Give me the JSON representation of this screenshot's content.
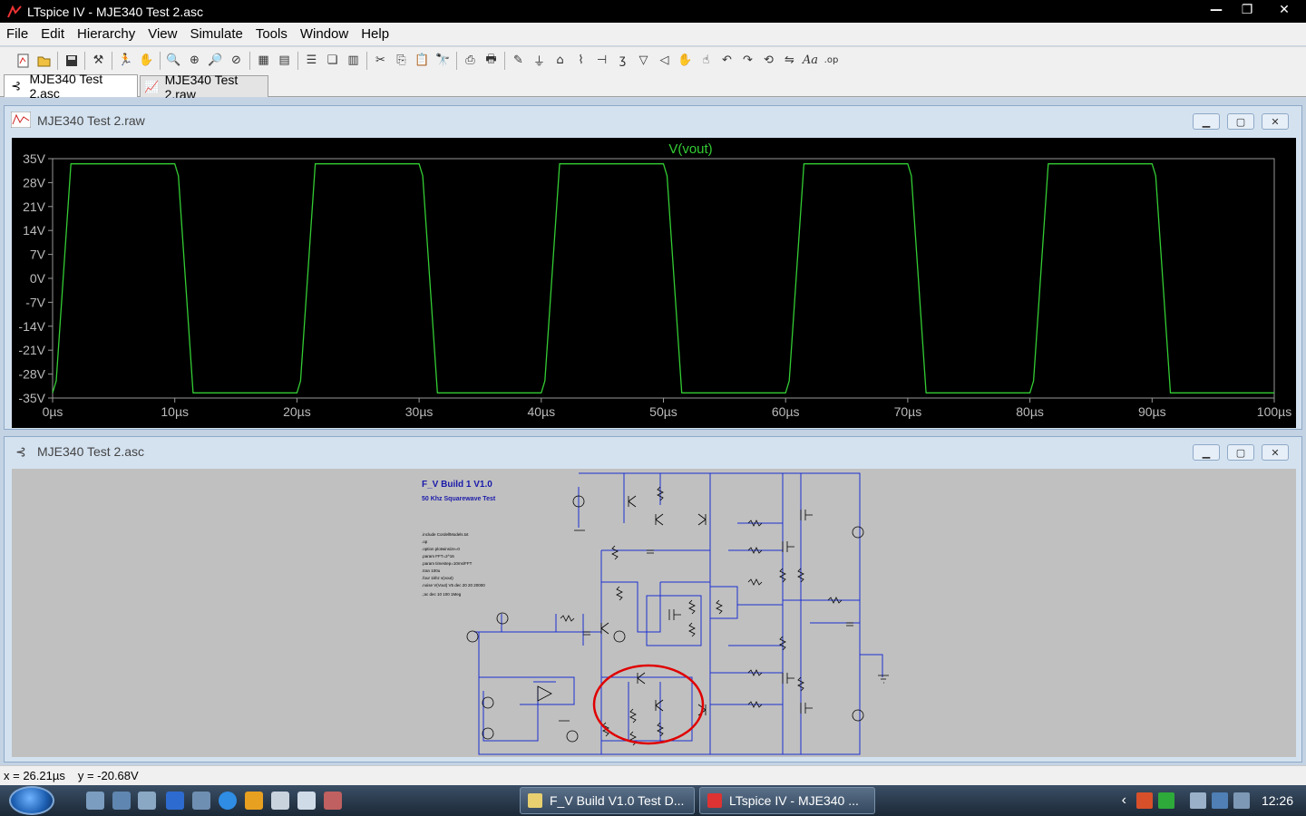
{
  "window": {
    "title": "LTspice IV - MJE340 Test 2.asc"
  },
  "menu": [
    "File",
    "Edit",
    "Hierarchy",
    "View",
    "Simulate",
    "Tools",
    "Window",
    "Help"
  ],
  "tabs": [
    {
      "label": "MJE340 Test 2.asc",
      "icon": "schematic-icon"
    },
    {
      "label": "MJE340 Test 2.raw",
      "icon": "waveform-icon"
    }
  ],
  "plot_window": {
    "title": "MJE340 Test 2.raw",
    "trace_label": "V(vout)",
    "trace_color": "#33cc33"
  },
  "schematic_window": {
    "title": "MJE340 Test 2.asc",
    "heading": "F_V Build 1 V1.0",
    "subheading": "50 Khz Squarewave Test",
    "directives": [
      ".include CordellModels.txt",
      ".op",
      ".option plotwinsize=0",
      ".param FFT=2^16",
      ".param timestep=10ms/FFT",
      ".tran 100u",
      ".four 1khz v(vout)",
      ".noise V(Vout) V5 dec 20 20 20000",
      ".;ac dec 10 100 1Meg"
    ],
    "annotation_color": "#e00000"
  },
  "chart_data": {
    "type": "line",
    "title": "V(vout)",
    "x_ticks": [
      "0µs",
      "10µs",
      "20µs",
      "30µs",
      "40µs",
      "50µs",
      "60µs",
      "70µs",
      "80µs",
      "90µs",
      "100µs"
    ],
    "y_ticks": [
      "35V",
      "28V",
      "21V",
      "14V",
      "7V",
      "0V",
      "-7V",
      "-14V",
      "-21V",
      "-28V",
      "-35V"
    ],
    "xlim": [
      0,
      100
    ],
    "ylim": [
      -35,
      35
    ],
    "x_unit": "µs",
    "y_unit": "V",
    "high": 33.5,
    "low": -33.5,
    "series": [
      {
        "name": "V(vout)",
        "x": [
          0,
          0.3,
          1.5,
          10,
          10.3,
          11.5,
          20,
          20.3,
          21.5,
          30,
          30.3,
          31.5,
          40,
          40.3,
          41.5,
          50,
          50.3,
          51.5,
          60,
          60.3,
          61.5,
          70,
          70.3,
          71.5,
          80,
          80.3,
          81.5,
          90,
          90.3,
          91.5,
          100
        ],
        "y": [
          -33.5,
          -30,
          33.5,
          33.5,
          30,
          -33.5,
          -33.5,
          -30,
          33.5,
          33.5,
          30,
          -33.5,
          -33.5,
          -30,
          33.5,
          33.5,
          30,
          -33.5,
          -33.5,
          -30,
          33.5,
          33.5,
          30,
          -33.5,
          -33.5,
          -30,
          33.5,
          33.5,
          30,
          -33.5,
          -33.5
        ]
      }
    ],
    "grid": false
  },
  "status": {
    "x": "x = 26.21µs",
    "y": "y = -20.68V"
  },
  "taskbar": {
    "tasks": [
      {
        "label": "F_V Build V1.0 Test D..."
      },
      {
        "label": "LTspice IV - MJE340 ..."
      }
    ],
    "clock": "12:26"
  }
}
